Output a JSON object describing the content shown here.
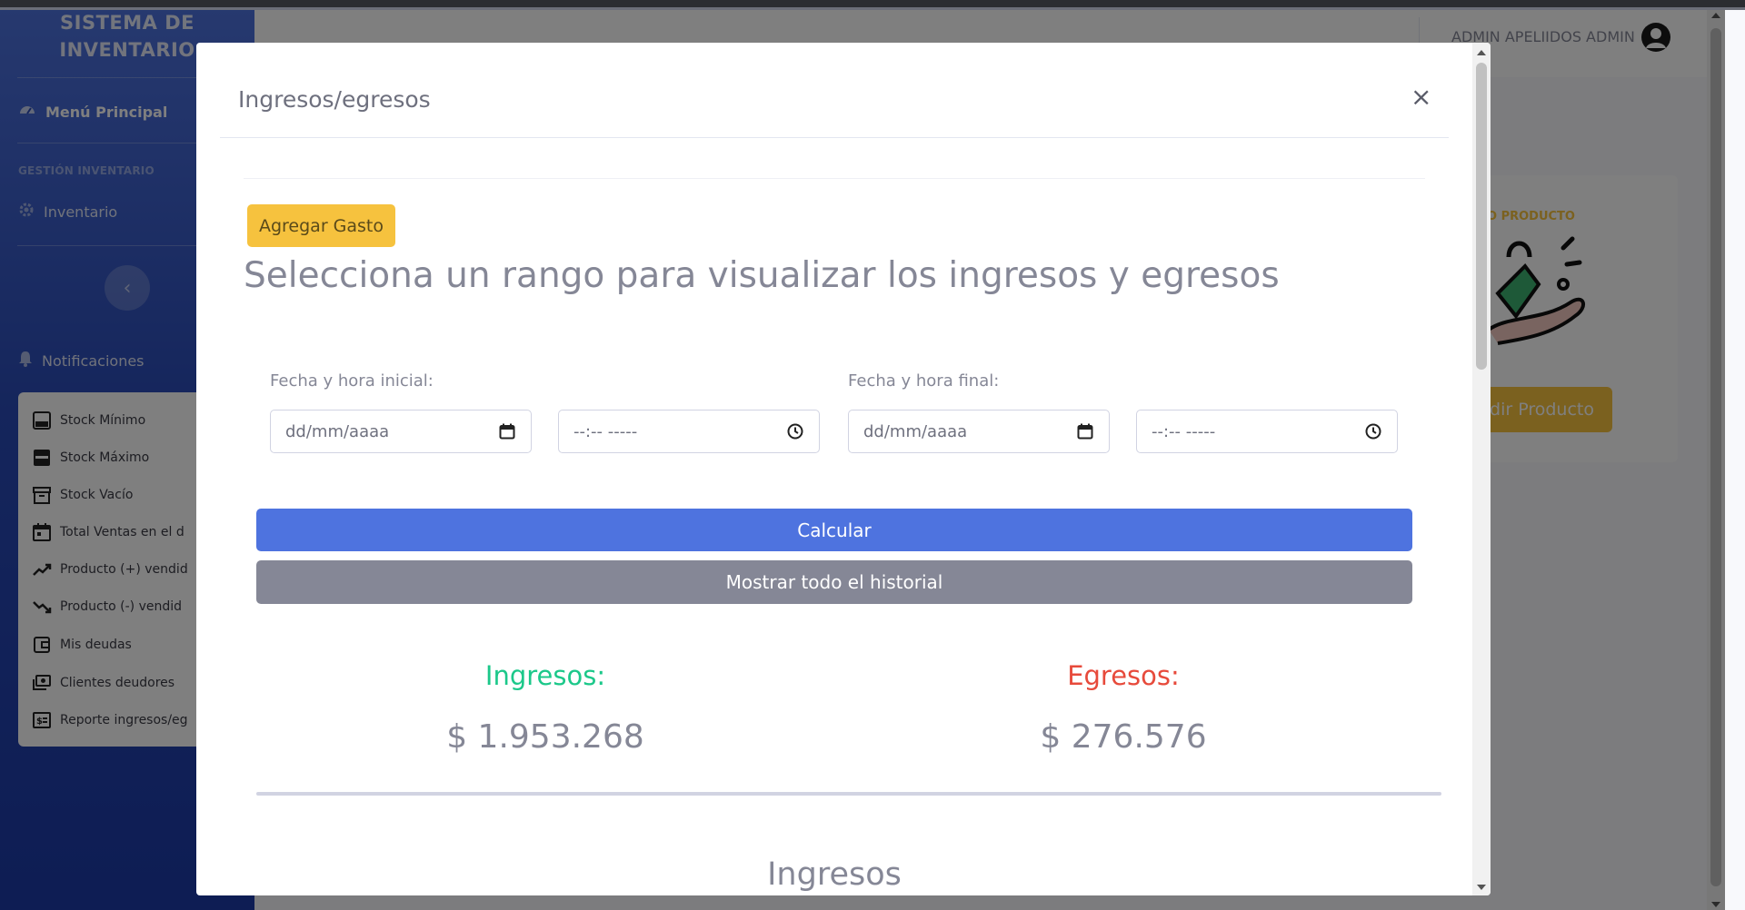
{
  "brand": {
    "line1": "SISTEMA DE",
    "line2": "INVENTARIO"
  },
  "sidebar": {
    "menu_principal": "Menú Principal",
    "heading_gestion": "Gestión Inventario",
    "inventario": "Inventario",
    "notificaciones": "Notificaciones",
    "notifications": [
      {
        "label": "Stock Mínimo",
        "icon": "inbox-icon"
      },
      {
        "label": "Stock Máximo",
        "icon": "inbox-full-icon"
      },
      {
        "label": "Stock Vacío",
        "icon": "archive-icon"
      },
      {
        "label": "Total Ventas en el d",
        "icon": "calendar-icon"
      },
      {
        "label": "Producto (+) vendid",
        "icon": "trend-up-icon"
      },
      {
        "label": "Producto (-) vendid",
        "icon": "trend-down-icon"
      },
      {
        "label": "Mis deudas",
        "icon": "wallet-icon"
      },
      {
        "label": "Clientes deudores",
        "icon": "money-icon"
      },
      {
        "label": "Reporte ingresos/eg",
        "icon": "report-money-icon"
      }
    ]
  },
  "topbar": {
    "user_name": "ADMIN APELIIDOS ADMIN"
  },
  "background_card": {
    "label": "O PRODUCTO",
    "button": "adir Producto"
  },
  "modal": {
    "title": "Ingresos/egresos",
    "close": "×",
    "add_expense_button": "Agregar Gasto",
    "heading": "Selecciona un rango para visualizar los ingresos y egresos",
    "start_label": "Fecha y hora inicial:",
    "end_label": "Fecha y hora final:",
    "start_date_placeholder": "dd/mm/aaaa",
    "start_time_placeholder": "--:-- -----",
    "end_date_placeholder": "dd/mm/aaaa",
    "end_time_placeholder": "--:-- -----",
    "calculate_button": "Calcular",
    "history_button": "Mostrar todo el historial",
    "income_label": "Ingresos:",
    "income_value": "$ 1.953.268",
    "expense_label": "Egresos:",
    "expense_value": "$ 276.576",
    "section_title": "Ingresos"
  },
  "colors": {
    "primary": "#4e73df",
    "warning": "#f6c23e",
    "secondary": "#858796",
    "success": "#1cc88a",
    "danger": "#e74a3b"
  }
}
